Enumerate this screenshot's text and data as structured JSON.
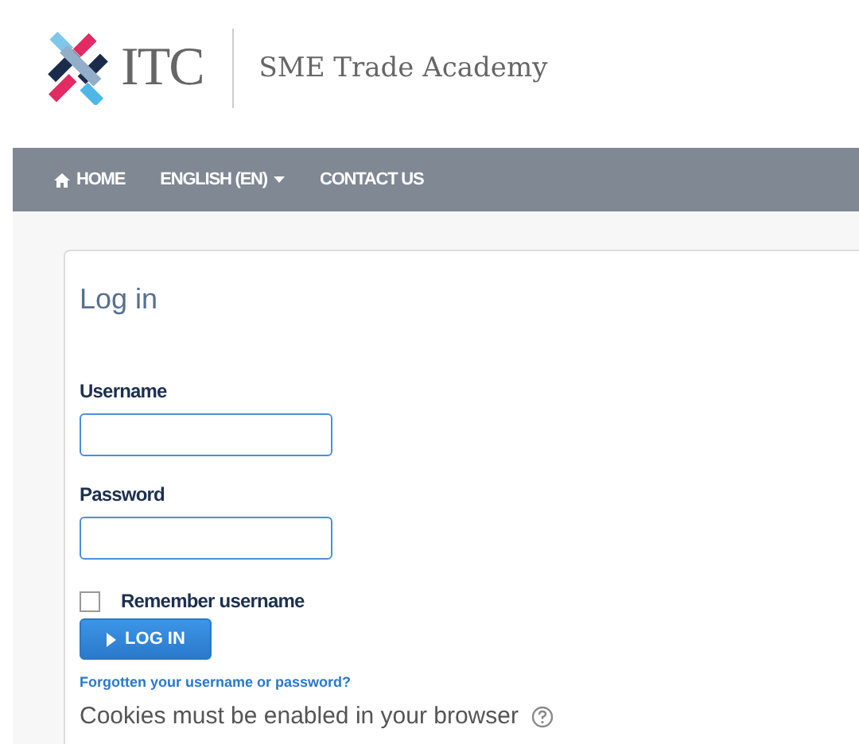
{
  "header": {
    "logo_text": "ITC",
    "tagline": "SME Trade Academy"
  },
  "nav": [
    {
      "label": "HOME",
      "kind": "home"
    },
    {
      "label": "ENGLISH (EN)",
      "kind": "dropdown"
    },
    {
      "label": "CONTACT US",
      "kind": "link"
    }
  ],
  "login": {
    "title": "Log in",
    "username_label": "Username",
    "password_label": "Password",
    "remember": {
      "label": "Remember username",
      "checked": false
    },
    "button": "LOG IN",
    "forgot_link": "Forgotten your username or password?",
    "cookies_note": "Cookies must be enabled in your browser"
  }
}
